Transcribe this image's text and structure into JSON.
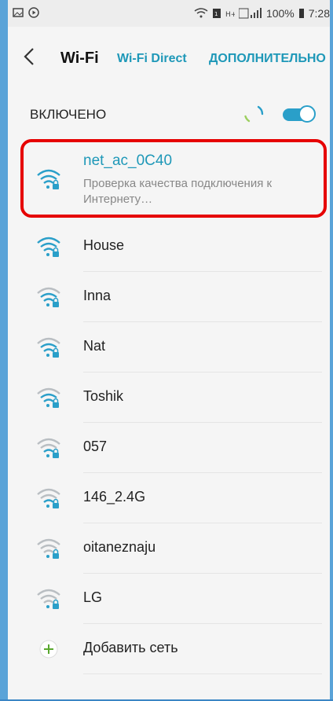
{
  "status_bar": {
    "battery": "100%",
    "time": "7:28"
  },
  "header": {
    "title": "Wi-Fi",
    "tab_direct": "Wi-Fi Direct",
    "tab_more": "ДОПОЛНИТЕЛЬНО"
  },
  "wifi_toggle": {
    "label": "ВКЛЮЧЕНО",
    "state": "on"
  },
  "networks": [
    {
      "name": "net_ac_0C40",
      "status": "Проверка качества подключения к Интернету…",
      "signal": "full",
      "secured": true
    },
    {
      "name": "House",
      "signal": "full",
      "secured": true
    },
    {
      "name": "Inna",
      "signal": "high",
      "secured": true
    },
    {
      "name": "Nat",
      "signal": "high",
      "secured": true
    },
    {
      "name": "Toshik",
      "signal": "high",
      "secured": true
    },
    {
      "name": "057",
      "signal": "medium",
      "secured": true
    },
    {
      "name": "146_2.4G",
      "signal": "medium",
      "secured": true
    },
    {
      "name": "oitaneznaju",
      "signal": "low",
      "secured": true
    },
    {
      "name": "LG",
      "signal": "low",
      "secured": true
    }
  ],
  "add_network": {
    "label": "Добавить сеть"
  },
  "colors": {
    "accent": "#1e98b8",
    "highlight": "#e60000",
    "background": "#f5f5f5"
  }
}
